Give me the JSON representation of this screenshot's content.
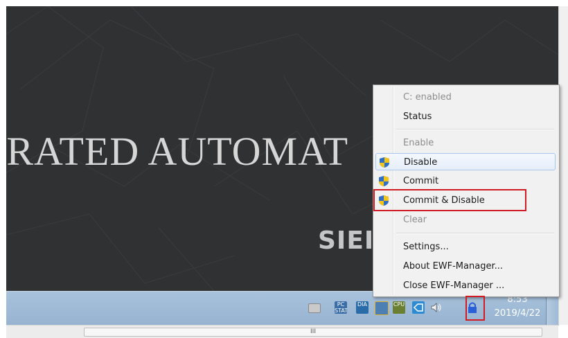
{
  "desktop": {
    "banner_text": "-RATED AUTOMAT",
    "brand_text": "SIEI"
  },
  "context_menu": {
    "items": [
      {
        "label": "C: enabled",
        "enabled": false
      },
      {
        "label": "Status",
        "enabled": true
      },
      {
        "label": "Enable",
        "enabled": false
      },
      {
        "label": "Disable",
        "enabled": true,
        "icon": "uac-shield-icon"
      },
      {
        "label": "Commit",
        "enabled": true,
        "icon": "uac-shield-icon"
      },
      {
        "label": "Commit & Disable",
        "enabled": true,
        "icon": "uac-shield-icon"
      },
      {
        "label": "Clear",
        "enabled": false
      },
      {
        "label": "Settings...",
        "enabled": true
      },
      {
        "label": "About EWF-Manager...",
        "enabled": true
      },
      {
        "label": "Close EWF-Manager ...",
        "enabled": true
      }
    ]
  },
  "taskbar": {
    "tray_icons": [
      {
        "name": "keyboard-icon",
        "text": ""
      },
      {
        "name": "pc-station-icon",
        "text": "PC STAT"
      },
      {
        "name": "diagnostics-icon",
        "text": "DIA"
      },
      {
        "name": "network-icon",
        "text": ""
      },
      {
        "name": "cpu-icon",
        "text": "CPU"
      },
      {
        "name": "vs-icon",
        "text": ""
      },
      {
        "name": "volume-icon",
        "text": ""
      },
      {
        "name": "ewf-lock-icon",
        "text": ""
      }
    ],
    "clock_time": "8:53",
    "clock_date": "2019/4/22"
  },
  "scrollbar": {
    "thumb_grip": "III"
  },
  "colors": {
    "highlight_box": "#d21a23",
    "menu_background": "#f1f1f1",
    "taskbar": "#9eb9d5"
  }
}
